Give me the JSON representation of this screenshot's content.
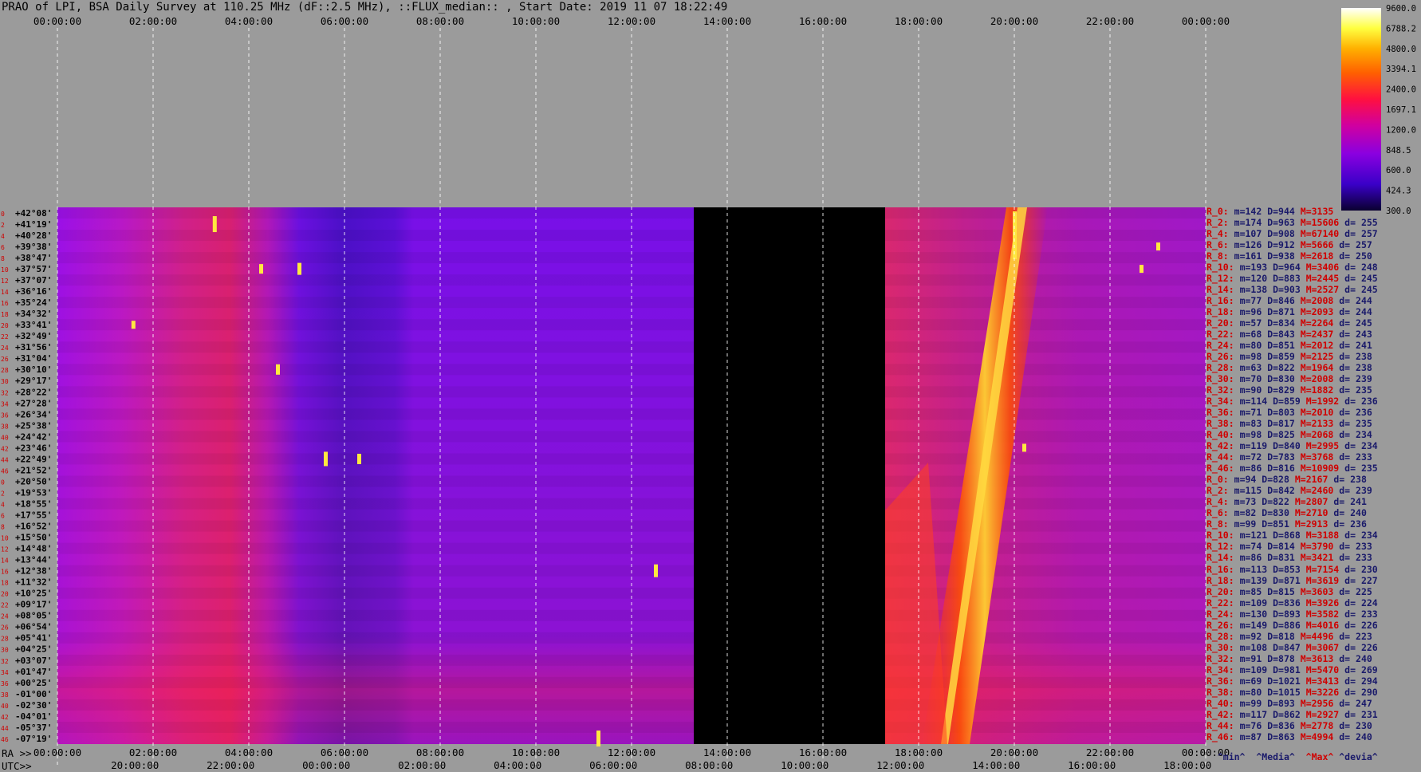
{
  "title": "PRAO of LPI, BSA Daily Survey at 110.25 MHz (dF::2.5 MHz), ::FLUX_median:: , Start Date: 2019 11 07 18:22:49",
  "colors": {
    "background": "#9b9b9b",
    "gap": "#000000",
    "grid": "#ffffff"
  },
  "chart_data": {
    "type": "heatmap",
    "title": "PRAO of LPI, BSA Daily Survey at 110.25 MHz (dF::2.5 MHz), ::FLUX_median:: , Start Date: 2019 11 07 18:22:49",
    "top_axis_ticks": [
      "00:00:00",
      "02:00:00",
      "04:00:00",
      "06:00:00",
      "08:00:00",
      "10:00:00",
      "12:00:00",
      "14:00:00",
      "16:00:00",
      "18:00:00",
      "20:00:00",
      "22:00:00",
      "00:00:00"
    ],
    "ra_axis_label": "RA >>",
    "ra_ticks": [
      "00:00:00",
      "02:00:00",
      "04:00:00",
      "06:00:00",
      "08:00:00",
      "10:00:00",
      "12:00:00",
      "14:00:00",
      "16:00:00",
      "18:00:00",
      "20:00:00",
      "22:00:00",
      "00:00:00"
    ],
    "utc_axis_label": "UTC>>",
    "utc_ticks": [
      "20:00:00",
      "22:00:00",
      "00:00:00",
      "02:00:00",
      "04:00:00",
      "06:00:00",
      "08:00:00",
      "10:00:00",
      "12:00:00",
      "14:00:00",
      "16:00:00",
      "18:00:00"
    ],
    "ra_range_hours": [
      0,
      24
    ],
    "data_gap_ra_hours": [
      13.3,
      17.3
    ],
    "declinations": [
      "+42°08'",
      "+41°19'",
      "+40°28'",
      "+39°38'",
      "+38°47'",
      "+37°57'",
      "+37°07'",
      "+36°16'",
      "+35°24'",
      "+34°32'",
      "+33°41'",
      "+32°49'",
      "+31°56'",
      "+31°04'",
      "+30°10'",
      "+29°17'",
      "+28°22'",
      "+27°28'",
      "+26°34'",
      "+25°38'",
      "+24°42'",
      "+23°46'",
      "+22°49'",
      "+21°52'",
      "+20°50'",
      "+19°53'",
      "+18°55'",
      "+17°55'",
      "+16°52'",
      "+15°50'",
      "+14°48'",
      "+13°44'",
      "+12°38'",
      "+11°32'",
      "+10°25'",
      "+09°17'",
      "+08°05'",
      "+06°54'",
      "+05°41'",
      "+04°25'",
      "+03°07'",
      "+01°47'",
      "+00°25'",
      "-01°00'",
      "-02°30'",
      "-04°01'",
      "-05°37'",
      "-07°19'"
    ],
    "row_indices": [
      "0",
      "2",
      "4",
      "6",
      "8",
      "10",
      "12",
      "14",
      "16",
      "18",
      "20",
      "22",
      "24",
      "26",
      "28",
      "30",
      "32",
      "34",
      "36",
      "38",
      "40",
      "42",
      "44",
      "46",
      "0",
      "2",
      "4",
      "6",
      "8",
      "10",
      "12",
      "14",
      "16",
      "18",
      "20",
      "22",
      "24",
      "26",
      "28",
      "30",
      "32",
      "34",
      "36",
      "38",
      "40",
      "42",
      "44",
      "46"
    ],
    "colorbar": {
      "colors": [
        "#0a0030",
        "#3a00c8",
        "#8a00e0",
        "#d000a0",
        "#ff1040",
        "#ff6000",
        "#ffb000",
        "#ffff40",
        "#ffffff"
      ],
      "ticks": [
        "9600.0",
        "6788.2",
        "4800.0",
        "3394.1",
        "2400.0",
        "1697.1",
        "1200.0",
        "848.5",
        "600.0",
        "424.3",
        "300.0"
      ]
    },
    "row_stats": [
      {
        "label": "R_0:",
        "min": "m=142",
        "median": "D=944",
        "max": "M=3135",
        "dev": ""
      },
      {
        "label": "R_2:",
        "min": "m=174",
        "median": "D=963",
        "max": "M=15606",
        "dev": "d= 255"
      },
      {
        "label": "R_4:",
        "min": "m=107",
        "median": "D=908",
        "max": "M=67140",
        "dev": "d= 257"
      },
      {
        "label": "R_6:",
        "min": "m=126",
        "median": "D=912",
        "max": "M=5666",
        "dev": "d= 257"
      },
      {
        "label": "R_8:",
        "min": "m=161",
        "median": "D=938",
        "max": "M=2618",
        "dev": "d= 250"
      },
      {
        "label": "R_10:",
        "min": "m=193",
        "median": "D=964",
        "max": "M=3406",
        "dev": "d= 248"
      },
      {
        "label": "R_12:",
        "min": "m=120",
        "median": "D=883",
        "max": "M=2445",
        "dev": "d= 245"
      },
      {
        "label": "R_14:",
        "min": "m=138",
        "median": "D=903",
        "max": "M=2527",
        "dev": "d= 245"
      },
      {
        "label": "R_16:",
        "min": "m=77",
        "median": "D=846",
        "max": "M=2008",
        "dev": "d= 244"
      },
      {
        "label": "R_18:",
        "min": "m=96",
        "median": "D=871",
        "max": "M=2093",
        "dev": "d= 244"
      },
      {
        "label": "R_20:",
        "min": "m=57",
        "median": "D=834",
        "max": "M=2264",
        "dev": "d= 245"
      },
      {
        "label": "R_22:",
        "min": "m=68",
        "median": "D=843",
        "max": "M=2437",
        "dev": "d= 243"
      },
      {
        "label": "R_24:",
        "min": "m=80",
        "median": "D=851",
        "max": "M=2012",
        "dev": "d= 241"
      },
      {
        "label": "R_26:",
        "min": "m=98",
        "median": "D=859",
        "max": "M=2125",
        "dev": "d= 238"
      },
      {
        "label": "R_28:",
        "min": "m=63",
        "median": "D=822",
        "max": "M=1964",
        "dev": "d= 238"
      },
      {
        "label": "R_30:",
        "min": "m=70",
        "median": "D=830",
        "max": "M=2008",
        "dev": "d= 239"
      },
      {
        "label": "R_32:",
        "min": "m=90",
        "median": "D=829",
        "max": "M=1882",
        "dev": "d= 235"
      },
      {
        "label": "R_34:",
        "min": "m=114",
        "median": "D=859",
        "max": "M=1992",
        "dev": "d= 236"
      },
      {
        "label": "R_36:",
        "min": "m=71",
        "median": "D=803",
        "max": "M=2010",
        "dev": "d= 236"
      },
      {
        "label": "R_38:",
        "min": "m=83",
        "median": "D=817",
        "max": "M=2133",
        "dev": "d= 235"
      },
      {
        "label": "R_40:",
        "min": "m=98",
        "median": "D=825",
        "max": "M=2068",
        "dev": "d= 234"
      },
      {
        "label": "R_42:",
        "min": "m=119",
        "median": "D=840",
        "max": "M=2995",
        "dev": "d= 234"
      },
      {
        "label": "R_44:",
        "min": "m=72",
        "median": "D=783",
        "max": "M=3768",
        "dev": "d= 233"
      },
      {
        "label": "R_46:",
        "min": "m=86",
        "median": "D=816",
        "max": "M=10909",
        "dev": "d= 235"
      },
      {
        "label": "R_0:",
        "min": "m=94",
        "median": "D=828",
        "max": "M=2167",
        "dev": "d= 238"
      },
      {
        "label": "R_2:",
        "min": "m=115",
        "median": "D=842",
        "max": "M=2460",
        "dev": "d= 239"
      },
      {
        "label": "R_4:",
        "min": "m=73",
        "median": "D=822",
        "max": "M=2807",
        "dev": "d= 241"
      },
      {
        "label": "R_6:",
        "min": "m=82",
        "median": "D=830",
        "max": "M=2710",
        "dev": "d= 240"
      },
      {
        "label": "R_8:",
        "min": "m=99",
        "median": "D=851",
        "max": "M=2913",
        "dev": "d= 236"
      },
      {
        "label": "R_10:",
        "min": "m=121",
        "median": "D=868",
        "max": "M=3188",
        "dev": "d= 234"
      },
      {
        "label": "R_12:",
        "min": "m=74",
        "median": "D=814",
        "max": "M=3790",
        "dev": "d= 233"
      },
      {
        "label": "R_14:",
        "min": "m=86",
        "median": "D=831",
        "max": "M=3421",
        "dev": "d= 233"
      },
      {
        "label": "R_16:",
        "min": "m=113",
        "median": "D=853",
        "max": "M=7154",
        "dev": "d= 230"
      },
      {
        "label": "R_18:",
        "min": "m=139",
        "median": "D=871",
        "max": "M=3619",
        "dev": "d= 227"
      },
      {
        "label": "R_20:",
        "min": "m=85",
        "median": "D=815",
        "max": "M=3603",
        "dev": "d= 225"
      },
      {
        "label": "R_22:",
        "min": "m=109",
        "median": "D=836",
        "max": "M=3926",
        "dev": "d= 224"
      },
      {
        "label": "R_24:",
        "min": "m=130",
        "median": "D=893",
        "max": "M=3582",
        "dev": "d= 233"
      },
      {
        "label": "R_26:",
        "min": "m=149",
        "median": "D=886",
        "max": "M=4016",
        "dev": "d= 226"
      },
      {
        "label": "R_28:",
        "min": "m=92",
        "median": "D=818",
        "max": "M=4496",
        "dev": "d= 223"
      },
      {
        "label": "R_30:",
        "min": "m=108",
        "median": "D=847",
        "max": "M=3067",
        "dev": "d= 226"
      },
      {
        "label": "R_32:",
        "min": "m=91",
        "median": "D=878",
        "max": "M=3613",
        "dev": "d= 240"
      },
      {
        "label": "R_34:",
        "min": "m=109",
        "median": "D=981",
        "max": "M=5470",
        "dev": "d= 269"
      },
      {
        "label": "R_36:",
        "min": "m=69",
        "median": "D=1021",
        "max": "M=3413",
        "dev": "d= 294"
      },
      {
        "label": "R_38:",
        "min": "m=80",
        "median": "D=1015",
        "max": "M=3226",
        "dev": "d= 290"
      },
      {
        "label": "R_40:",
        "min": "m=99",
        "median": "D=893",
        "max": "M=2956",
        "dev": "d= 247"
      },
      {
        "label": "R_42:",
        "min": "m=117",
        "median": "D=862",
        "max": "M=2927",
        "dev": "d= 231"
      },
      {
        "label": "R_44:",
        "min": "m=76",
        "median": "D=836",
        "max": "M=2778",
        "dev": "d= 230"
      },
      {
        "label": "R_46:",
        "min": "m=87",
        "median": "D=863",
        "max": "M=4994",
        "dev": "d= 240"
      }
    ],
    "stats_legend": {
      "min": "^min^",
      "median": "^Media^",
      "max": "^Max^",
      "dev": "^devia^"
    }
  }
}
